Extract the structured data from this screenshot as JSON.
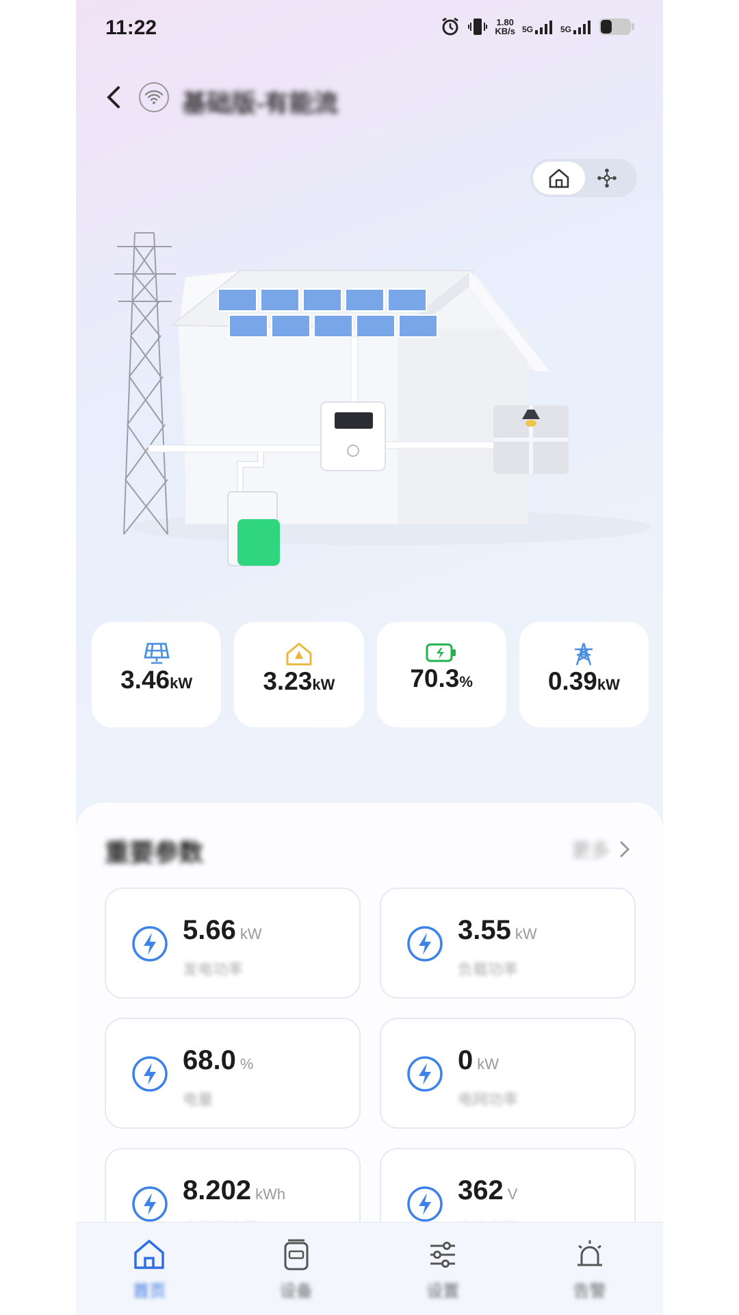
{
  "status_bar": {
    "time": "11:22",
    "speed_value": "1.80",
    "speed_unit": "KB/s",
    "sim1": "5G",
    "sim2": "5G"
  },
  "header": {
    "back_icon": "chevron-left-icon",
    "device_icon": "wifi-icon",
    "device_name": "基础版-有能流"
  },
  "view_toggle": {
    "options": [
      {
        "icon": "home-icon",
        "selected": true
      },
      {
        "icon": "flow-icon",
        "selected": false
      }
    ]
  },
  "summary": [
    {
      "icon": "solar-panel-icon",
      "value": "3.46",
      "unit": "kW",
      "color": "#4a8fe0"
    },
    {
      "icon": "home-load-icon",
      "value": "3.23",
      "unit": "kW",
      "color": "#e9b83c"
    },
    {
      "icon": "battery-icon",
      "value": "70.3",
      "unit": "%",
      "color": "#22b14c"
    },
    {
      "icon": "grid-tower-icon",
      "value": "0.39",
      "unit": "kW",
      "color": "#4a8fe0"
    }
  ],
  "params": {
    "title": "重要参数",
    "more_label": "更多",
    "items": [
      {
        "value": "5.66",
        "unit": "kW",
        "label": "发电功率"
      },
      {
        "value": "3.55",
        "unit": "kW",
        "label": "负载功率"
      },
      {
        "value": "68.0",
        "unit": "%",
        "label": "电量"
      },
      {
        "value": "0",
        "unit": "kW",
        "label": "电网功率"
      },
      {
        "value": "8.202",
        "unit": "kWh",
        "label": "今日发电量"
      },
      {
        "value": "362",
        "unit": "V",
        "label": "电池电压"
      }
    ]
  },
  "tabbar": [
    {
      "icon": "home-icon",
      "label": "首页",
      "active": true
    },
    {
      "icon": "device-icon",
      "label": "设备",
      "active": false
    },
    {
      "icon": "settings-sliders-icon",
      "label": "设置",
      "active": false
    },
    {
      "icon": "alarm-bell-icon",
      "label": "告警",
      "active": false
    }
  ],
  "colors": {
    "accent": "#2f6fdf",
    "battery_green": "#2fd57f"
  }
}
